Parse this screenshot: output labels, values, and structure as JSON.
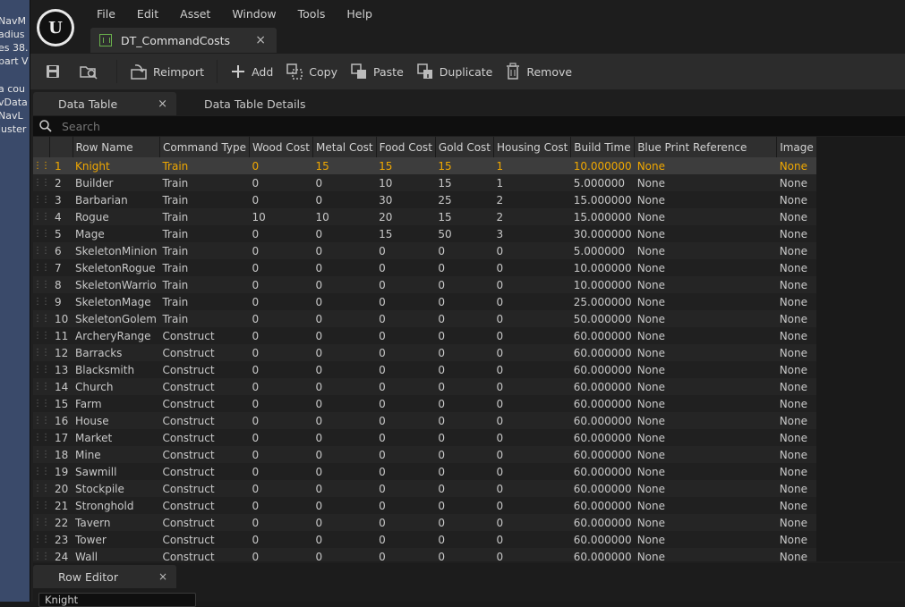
{
  "background_viewport": {
    "lines": [
      "NavM",
      "adius",
      "es 38.",
      "part V",
      "",
      "a cou",
      "vData",
      "NavL",
      "luster"
    ]
  },
  "menu": [
    "File",
    "Edit",
    "Asset",
    "Window",
    "Tools",
    "Help"
  ],
  "asset_tab": {
    "label": "DT_CommandCosts",
    "close": "×"
  },
  "toolbar": {
    "reimport": "Reimport",
    "add": "Add",
    "copy": "Copy",
    "paste": "Paste",
    "duplicate": "Duplicate",
    "remove": "Remove"
  },
  "panel_tabs": {
    "data_table": "Data Table",
    "close": "×",
    "details": "Data Table Details"
  },
  "search": {
    "placeholder": "Search",
    "value": ""
  },
  "table": {
    "columns": [
      "Row Name",
      "Command Type",
      "Wood Cost",
      "Metal Cost",
      "Food Cost",
      "Gold Cost",
      "Housing Cost",
      "Build Time",
      "Blue Print Reference",
      "Image"
    ],
    "selected_row": 1,
    "rows": [
      [
        "1",
        "Knight",
        "Train",
        "0",
        "15",
        "15",
        "15",
        "1",
        "10.000000",
        "None",
        "None"
      ],
      [
        "2",
        "Builder",
        "Train",
        "0",
        "0",
        "10",
        "15",
        "1",
        "5.000000",
        "None",
        "None"
      ],
      [
        "3",
        "Barbarian",
        "Train",
        "0",
        "0",
        "30",
        "25",
        "2",
        "15.000000",
        "None",
        "None"
      ],
      [
        "4",
        "Rogue",
        "Train",
        "10",
        "10",
        "20",
        "15",
        "2",
        "15.000000",
        "None",
        "None"
      ],
      [
        "5",
        "Mage",
        "Train",
        "0",
        "0",
        "15",
        "50",
        "3",
        "30.000000",
        "None",
        "None"
      ],
      [
        "6",
        "SkeletonMinion",
        "Train",
        "0",
        "0",
        "0",
        "0",
        "0",
        "5.000000",
        "None",
        "None"
      ],
      [
        "7",
        "SkeletonRogue",
        "Train",
        "0",
        "0",
        "0",
        "0",
        "0",
        "10.000000",
        "None",
        "None"
      ],
      [
        "8",
        "SkeletonWarrio",
        "Train",
        "0",
        "0",
        "0",
        "0",
        "0",
        "10.000000",
        "None",
        "None"
      ],
      [
        "9",
        "SkeletonMage",
        "Train",
        "0",
        "0",
        "0",
        "0",
        "0",
        "25.000000",
        "None",
        "None"
      ],
      [
        "10",
        "SkeletonGolem",
        "Train",
        "0",
        "0",
        "0",
        "0",
        "0",
        "50.000000",
        "None",
        "None"
      ],
      [
        "11",
        "ArcheryRange",
        "Construct",
        "0",
        "0",
        "0",
        "0",
        "0",
        "60.000000",
        "None",
        "None"
      ],
      [
        "12",
        "Barracks",
        "Construct",
        "0",
        "0",
        "0",
        "0",
        "0",
        "60.000000",
        "None",
        "None"
      ],
      [
        "13",
        "Blacksmith",
        "Construct",
        "0",
        "0",
        "0",
        "0",
        "0",
        "60.000000",
        "None",
        "None"
      ],
      [
        "14",
        "Church",
        "Construct",
        "0",
        "0",
        "0",
        "0",
        "0",
        "60.000000",
        "None",
        "None"
      ],
      [
        "15",
        "Farm",
        "Construct",
        "0",
        "0",
        "0",
        "0",
        "0",
        "60.000000",
        "None",
        "None"
      ],
      [
        "16",
        "House",
        "Construct",
        "0",
        "0",
        "0",
        "0",
        "0",
        "60.000000",
        "None",
        "None"
      ],
      [
        "17",
        "Market",
        "Construct",
        "0",
        "0",
        "0",
        "0",
        "0",
        "60.000000",
        "None",
        "None"
      ],
      [
        "18",
        "Mine",
        "Construct",
        "0",
        "0",
        "0",
        "0",
        "0",
        "60.000000",
        "None",
        "None"
      ],
      [
        "19",
        "Sawmill",
        "Construct",
        "0",
        "0",
        "0",
        "0",
        "0",
        "60.000000",
        "None",
        "None"
      ],
      [
        "20",
        "Stockpile",
        "Construct",
        "0",
        "0",
        "0",
        "0",
        "0",
        "60.000000",
        "None",
        "None"
      ],
      [
        "21",
        "Stronghold",
        "Construct",
        "0",
        "0",
        "0",
        "0",
        "0",
        "60.000000",
        "None",
        "None"
      ],
      [
        "22",
        "Tavern",
        "Construct",
        "0",
        "0",
        "0",
        "0",
        "0",
        "60.000000",
        "None",
        "None"
      ],
      [
        "23",
        "Tower",
        "Construct",
        "0",
        "0",
        "0",
        "0",
        "0",
        "60.000000",
        "None",
        "None"
      ],
      [
        "24",
        "Wall",
        "Construct",
        "0",
        "0",
        "0",
        "0",
        "0",
        "60.000000",
        "None",
        "None"
      ]
    ]
  },
  "row_editor": {
    "tab": "Row Editor",
    "close": "×",
    "selected": "Knight"
  },
  "colors": {
    "selected_text": "#f0a800",
    "icon_green": "#6ab04c"
  }
}
